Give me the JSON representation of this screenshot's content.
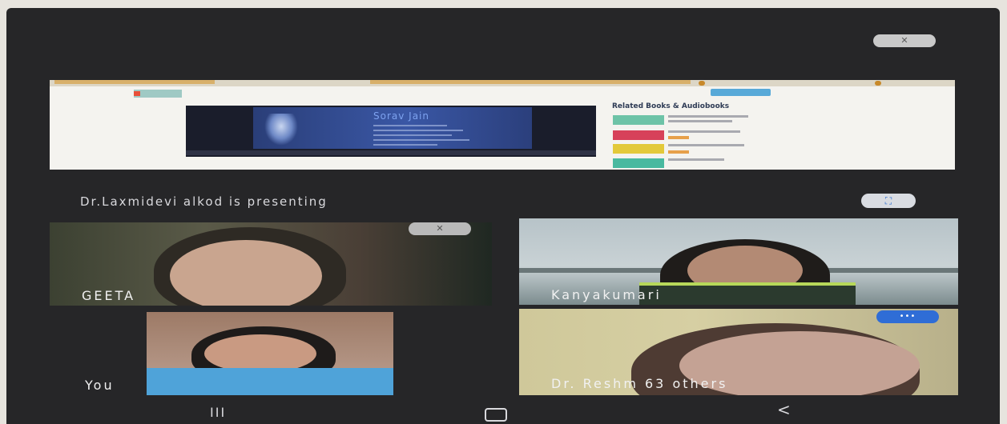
{
  "meeting": {
    "presenting_label": "Dr.Laxmidevi alkod is presenting"
  },
  "icons": {
    "top_toggle": "mic-off-icon",
    "fullscreen": "fullscreen-icon",
    "mute": "mic-off-icon",
    "speaking": "speaking-dots-icon"
  },
  "icon_glyphs": {
    "mic_off": "✕",
    "fullscreen": "⛶",
    "speaking": "•••"
  },
  "shared_screen": {
    "video_title": "Sorav Jain",
    "related_heading": "Related Books & Audiobooks"
  },
  "participants": [
    {
      "name": "GEETA"
    },
    {
      "name": "Kanyakumari"
    },
    {
      "name": "You"
    },
    {
      "name": "Dr. Reshm  63 others"
    }
  ],
  "nav": {
    "recents": "III",
    "back": "<"
  },
  "colors": {
    "background": "#262628",
    "accent_blue": "#2f6dd6"
  }
}
